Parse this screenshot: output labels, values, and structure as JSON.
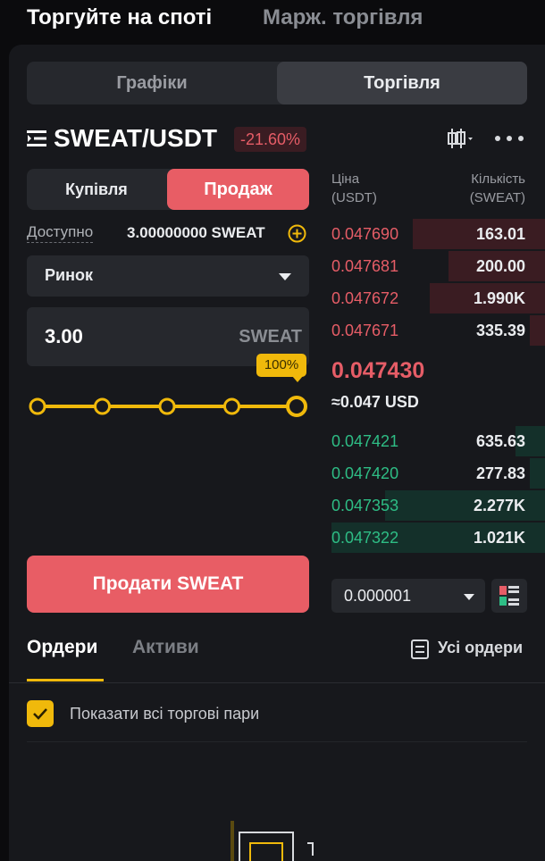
{
  "top_tabs": {
    "spot": "Торгуйте на споті",
    "margin": "Марж. торгівля"
  },
  "view_switch": {
    "charts": "Графіки",
    "trade": "Торгівля"
  },
  "pair": {
    "name": "SWEAT/USDT",
    "change": "-21.60%"
  },
  "order_form": {
    "buy_label": "Купівля",
    "sell_label": "Продаж",
    "available_label": "Доступно",
    "available_value": "3.00000000 SWEAT",
    "order_type": "Ринок",
    "quantity_value": "3.00",
    "quantity_unit": "SWEAT",
    "percent_label": "100%",
    "slider_fraction": 1.0,
    "submit_label": "Продати SWEAT"
  },
  "order_book": {
    "price_header_line1": "Ціна",
    "price_header_line2": "(USDT)",
    "qty_header_line1": "Кількість",
    "qty_header_line2": "(SWEAT)",
    "asks": [
      {
        "price": "0.047690",
        "qty": "163.01",
        "depth": 0.62
      },
      {
        "price": "0.047681",
        "qty": "200.00",
        "depth": 0.45
      },
      {
        "price": "0.047672",
        "qty": "1.990K",
        "depth": 0.54
      },
      {
        "price": "0.047671",
        "qty": "335.39",
        "depth": 0.07
      }
    ],
    "mid_price": "0.047430",
    "mid_usd": "≈0.047 USD",
    "bids": [
      {
        "price": "0.047421",
        "qty": "635.63",
        "depth": 0.14
      },
      {
        "price": "0.047420",
        "qty": "277.83",
        "depth": 0.07
      },
      {
        "price": "0.047353",
        "qty": "2.277K",
        "depth": 0.75
      },
      {
        "price": "0.047322",
        "qty": "1.021K",
        "depth": 1.0
      }
    ],
    "tick_size": "0.000001"
  },
  "orders": {
    "orders_tab": "Ордери",
    "assets_tab": "Активи",
    "all_orders": "Усі ордери",
    "show_all_pairs": "Показати всі торгові пари"
  },
  "colors": {
    "sell": "#e85d65",
    "buy": "#2ebd85",
    "accent": "#f0b90b"
  }
}
